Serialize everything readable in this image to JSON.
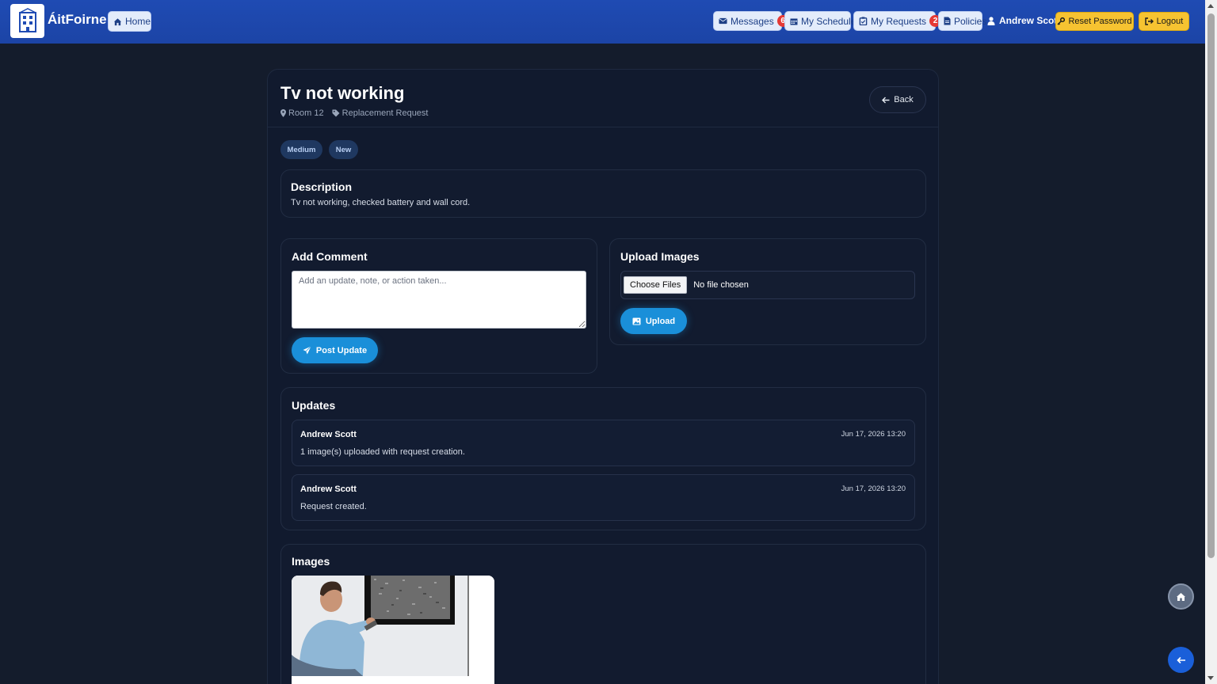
{
  "brand": {
    "name": "ÁitFoirne",
    "logo_icon": "building-icon"
  },
  "nav": {
    "home_label": "Home",
    "messages_label": "Messages",
    "messages_count": "6",
    "schedule_label": "My Schedule",
    "requests_label": "My Requests",
    "requests_count": "2",
    "policies_label": "Policies",
    "user_name": "Andrew Scott",
    "reset_password_label": "Reset Password",
    "logout_label": "Logout"
  },
  "request": {
    "title": "Tv not working",
    "room": "Room 12",
    "type": "Replacement Request",
    "back_label": "Back",
    "priority": "Medium",
    "status": "New"
  },
  "description": {
    "title": "Description",
    "text": "Tv not working, checked battery and wall cord."
  },
  "comment": {
    "title": "Add Comment",
    "placeholder": "Add an update, note, or action taken...",
    "value": "",
    "submit_label": "Post Update"
  },
  "upload": {
    "title": "Upload Images",
    "choose_label": "Choose Files",
    "file_status": "No file chosen",
    "submit_label": "Upload"
  },
  "updates": {
    "title": "Updates",
    "items": [
      {
        "author": "Andrew Scott",
        "time": "Jun 17, 2026 13:20",
        "text": "1 image(s) uploaded with request creation."
      },
      {
        "author": "Andrew Scott",
        "time": "Jun 17, 2026 13:20",
        "text": "Request created."
      }
    ]
  },
  "images": {
    "title": "Images"
  },
  "colors": {
    "navbar": "#1f4bb3",
    "background": "#141c2c",
    "card": "#111a2e",
    "accent": "#1a8fd9",
    "warning": "#f6c331",
    "badge": "#e53935"
  }
}
